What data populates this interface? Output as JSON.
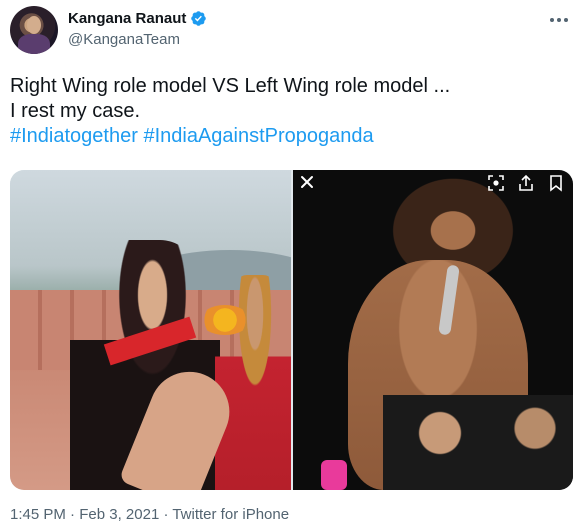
{
  "author": {
    "display_name": "Kangana Ranaut",
    "handle": "@KanganaTeam",
    "verified": true
  },
  "tweet": {
    "line1": "Right Wing role model VS Left Wing role model ...",
    "line2": "I rest my case.",
    "hashtags": [
      "#Indiatogether",
      "#IndiaAgainstPropoganda"
    ]
  },
  "media": {
    "photos": [
      "photo-left",
      "photo-right"
    ],
    "icons": [
      "close-icon",
      "lens-icon",
      "share-icon",
      "bookmark-icon"
    ]
  },
  "meta": {
    "time": "1:45 PM",
    "separator1": " · ",
    "date": "Feb 3, 2021",
    "separator2": " · ",
    "source": "Twitter for iPhone"
  },
  "colors": {
    "accent": "#1d9bf0",
    "secondary_text": "#536471",
    "boot_pink": "#e93a9b"
  }
}
